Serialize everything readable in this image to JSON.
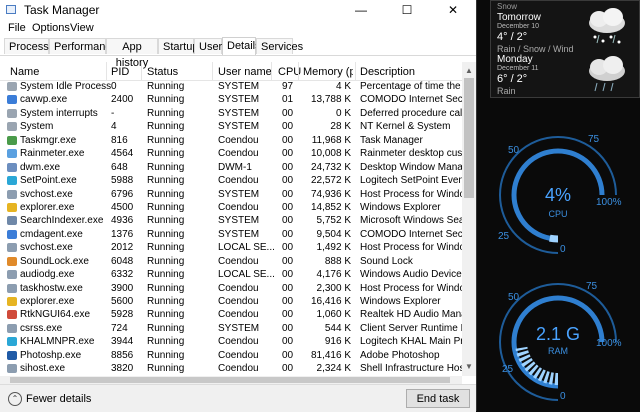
{
  "window": {
    "title": "Task Manager",
    "minimize": "—",
    "maximize": "☐",
    "close": "✕"
  },
  "menu": [
    "File",
    "Options",
    "View"
  ],
  "tabs": [
    "Processes",
    "Performance",
    "App history",
    "Startup",
    "Users",
    "Details",
    "Services"
  ],
  "active_tab": "Details",
  "columns": [
    "Name",
    "PID",
    "Status",
    "User name",
    "CPU",
    "Memory (p...",
    "Description"
  ],
  "rows": [
    {
      "name": "System Idle Process",
      "pid": "0",
      "status": "Running",
      "user": "SYSTEM",
      "cpu": "97",
      "mem": "4 K",
      "desc": "Percentage of time the proce",
      "icon": "#9aa5b1"
    },
    {
      "name": "cavwp.exe",
      "pid": "2400",
      "status": "Running",
      "user": "SYSTEM",
      "cpu": "01",
      "mem": "13,788 K",
      "desc": "COMODO Internet Security",
      "icon": "#3b7dd8"
    },
    {
      "name": "System interrupts",
      "pid": "-",
      "status": "Running",
      "user": "SYSTEM",
      "cpu": "00",
      "mem": "0 K",
      "desc": "Deferred procedure calls an",
      "icon": "#9aa5b1"
    },
    {
      "name": "System",
      "pid": "4",
      "status": "Running",
      "user": "SYSTEM",
      "cpu": "00",
      "mem": "28 K",
      "desc": "NT Kernel & System",
      "icon": "#9aa5b1"
    },
    {
      "name": "Taskmgr.exe",
      "pid": "816",
      "status": "Running",
      "user": "Coendou",
      "cpu": "00",
      "mem": "11,968 K",
      "desc": "Task Manager",
      "icon": "#4a9b4a"
    },
    {
      "name": "Rainmeter.exe",
      "pid": "4564",
      "status": "Running",
      "user": "Coendou",
      "cpu": "00",
      "mem": "10,008 K",
      "desc": "Rainmeter desktop customi",
      "icon": "#5aa0e0"
    },
    {
      "name": "dwm.exe",
      "pid": "648",
      "status": "Running",
      "user": "DWM-1",
      "cpu": "00",
      "mem": "24,732 K",
      "desc": "Desktop Window Manager",
      "icon": "#6c8ebf"
    },
    {
      "name": "SetPoint.exe",
      "pid": "5988",
      "status": "Running",
      "user": "Coendou",
      "cpu": "00",
      "mem": "22,572 K",
      "desc": "Logitech SetPoint Event Ma",
      "icon": "#2aa7d6"
    },
    {
      "name": "svchost.exe",
      "pid": "6796",
      "status": "Running",
      "user": "SYSTEM",
      "cpu": "00",
      "mem": "74,936 K",
      "desc": "Host Process for Windows S",
      "icon": "#8c9db0"
    },
    {
      "name": "explorer.exe",
      "pid": "4500",
      "status": "Running",
      "user": "Coendou",
      "cpu": "00",
      "mem": "14,852 K",
      "desc": "Windows Explorer",
      "icon": "#e6b422"
    },
    {
      "name": "SearchIndexer.exe",
      "pid": "4936",
      "status": "Running",
      "user": "SYSTEM",
      "cpu": "00",
      "mem": "5,752 K",
      "desc": "Microsoft Windows Search",
      "icon": "#6f88a8"
    },
    {
      "name": "cmdagent.exe",
      "pid": "1376",
      "status": "Running",
      "user": "SYSTEM",
      "cpu": "00",
      "mem": "9,504 K",
      "desc": "COMODO Internet Security",
      "icon": "#3b7dd8"
    },
    {
      "name": "svchost.exe",
      "pid": "2012",
      "status": "Running",
      "user": "LOCAL SE...",
      "cpu": "00",
      "mem": "1,492 K",
      "desc": "Host Process for Windows S",
      "icon": "#8c9db0"
    },
    {
      "name": "SoundLock.exe",
      "pid": "6048",
      "status": "Running",
      "user": "Coendou",
      "cpu": "00",
      "mem": "888 K",
      "desc": "Sound Lock",
      "icon": "#e08a2a"
    },
    {
      "name": "audiodg.exe",
      "pid": "6332",
      "status": "Running",
      "user": "LOCAL SE...",
      "cpu": "00",
      "mem": "4,176 K",
      "desc": "Windows Audio Device Grap",
      "icon": "#8c9db0"
    },
    {
      "name": "taskhostw.exe",
      "pid": "3900",
      "status": "Running",
      "user": "Coendou",
      "cpu": "00",
      "mem": "2,300 K",
      "desc": "Host Process for Windows T",
      "icon": "#8c9db0"
    },
    {
      "name": "explorer.exe",
      "pid": "5600",
      "status": "Running",
      "user": "Coendou",
      "cpu": "00",
      "mem": "16,416 K",
      "desc": "Windows Explorer",
      "icon": "#e6b422"
    },
    {
      "name": "RtkNGUI64.exe",
      "pid": "5928",
      "status": "Running",
      "user": "Coendou",
      "cpu": "00",
      "mem": "1,060 K",
      "desc": "Realtek HD Audio Manager",
      "icon": "#d04a3a"
    },
    {
      "name": "csrss.exe",
      "pid": "724",
      "status": "Running",
      "user": "SYSTEM",
      "cpu": "00",
      "mem": "544 K",
      "desc": "Client Server Runtime Proce",
      "icon": "#8c9db0"
    },
    {
      "name": "KHALMNPR.exe",
      "pid": "3944",
      "status": "Running",
      "user": "Coendou",
      "cpu": "00",
      "mem": "916 K",
      "desc": "Logitech KHAL Main Proces",
      "icon": "#2aa7d6"
    },
    {
      "name": "Photoshp.exe",
      "pid": "8856",
      "status": "Running",
      "user": "Coendou",
      "cpu": "00",
      "mem": "81,416 K",
      "desc": "Adobe Photoshop",
      "icon": "#1f5aa6"
    },
    {
      "name": "sihost.exe",
      "pid": "3820",
      "status": "Running",
      "user": "Coendou",
      "cpu": "00",
      "mem": "2,324 K",
      "desc": "Shell Infrastructure Host",
      "icon": "#8c9db0"
    }
  ],
  "footer": {
    "fewer_details": "Fewer details",
    "end_task": "End task"
  },
  "weather": {
    "top_partial": "Snow",
    "day1": {
      "day": "Tomorrow",
      "date": "December 10",
      "temp": "4° / 2°",
      "cond": "Rain / Snow / Wind"
    },
    "day2": {
      "day": "Monday",
      "date": "December 11",
      "temp": "6° / 2°",
      "cond": "Rain"
    }
  },
  "cpu_gauge": {
    "value": "4%",
    "label": "CPU",
    "level_percent": 4,
    "ticks": {
      "t25": "25",
      "t50": "50",
      "t75": "75",
      "t100": "100%",
      "t0": "0"
    },
    "accent": "#2f7fd0"
  },
  "ram_gauge": {
    "value": "2.1 G",
    "label": "RAM",
    "level_percent": 30,
    "ticks": {
      "t25": "25",
      "t50": "50",
      "t75": "75",
      "t100": "100%",
      "t0": "0"
    },
    "accent": "#2f7fd0"
  }
}
